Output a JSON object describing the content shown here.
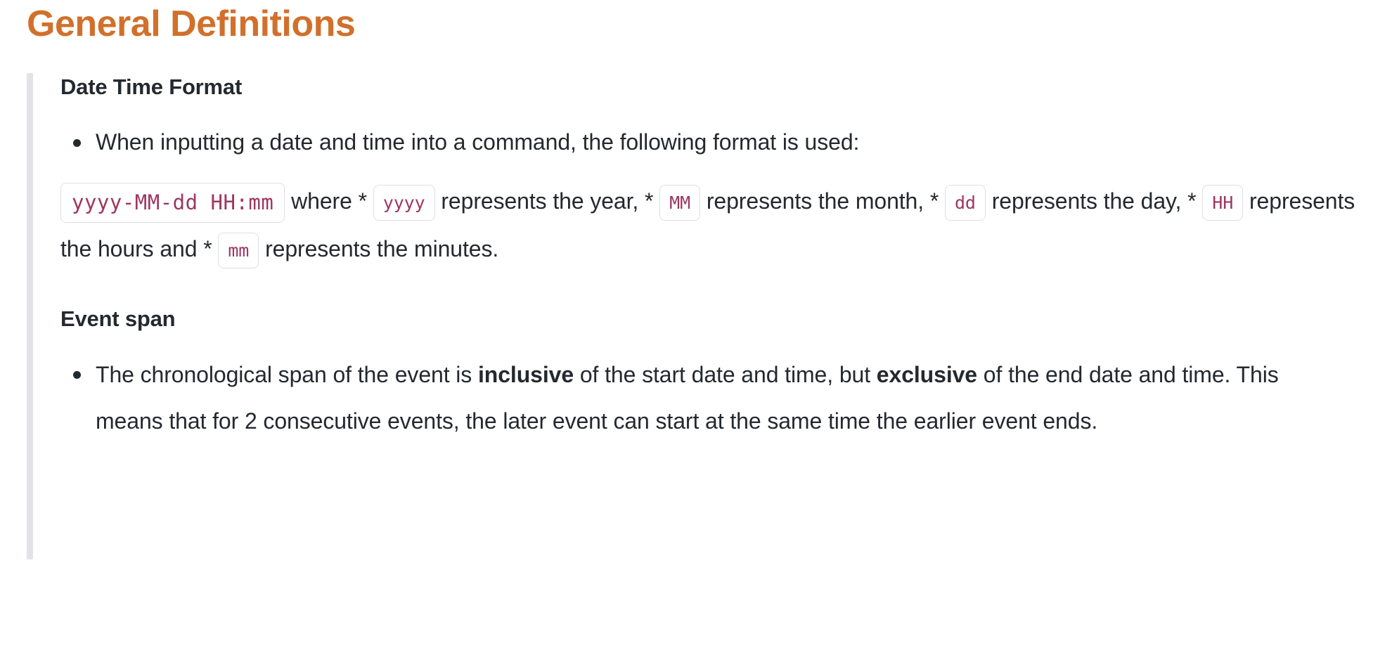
{
  "page": {
    "title": "General Definitions",
    "title_color": "#d1702b",
    "background": "#ffffff",
    "text_color": "#24292f",
    "code_color": "#9d3760",
    "callout_bar_color": "#e1e3e6",
    "chip_border_color": "#dcdfe3"
  },
  "sections": [
    {
      "heading": "Date Time Format",
      "bullets": [
        "When inputting a date and time into a command, the following format is used:"
      ],
      "format_paragraph": {
        "code_format": "yyyy-MM-dd HH:mm",
        "text_1": "where *",
        "chip_yyyy": "yyyy",
        "text_2": "represents the year, *",
        "chip_MM": "MM",
        "text_3": "represents the month, *",
        "chip_dd": "dd",
        "text_4": "represents the day, *",
        "chip_HH": "HH",
        "text_5": "represents the hours and *",
        "chip_mm": "mm",
        "text_6": "represents the minutes."
      }
    },
    {
      "heading": "Event span",
      "bullet": {
        "part_1": "The chronological span of the event is ",
        "bold_1": "inclusive",
        "part_2": " of the start date and time, but ",
        "bold_2": "exclusive",
        "part_3": " of the end date and time. This means that for 2 consecutive events, the later event can start at the same time the earlier event ends."
      }
    }
  ]
}
